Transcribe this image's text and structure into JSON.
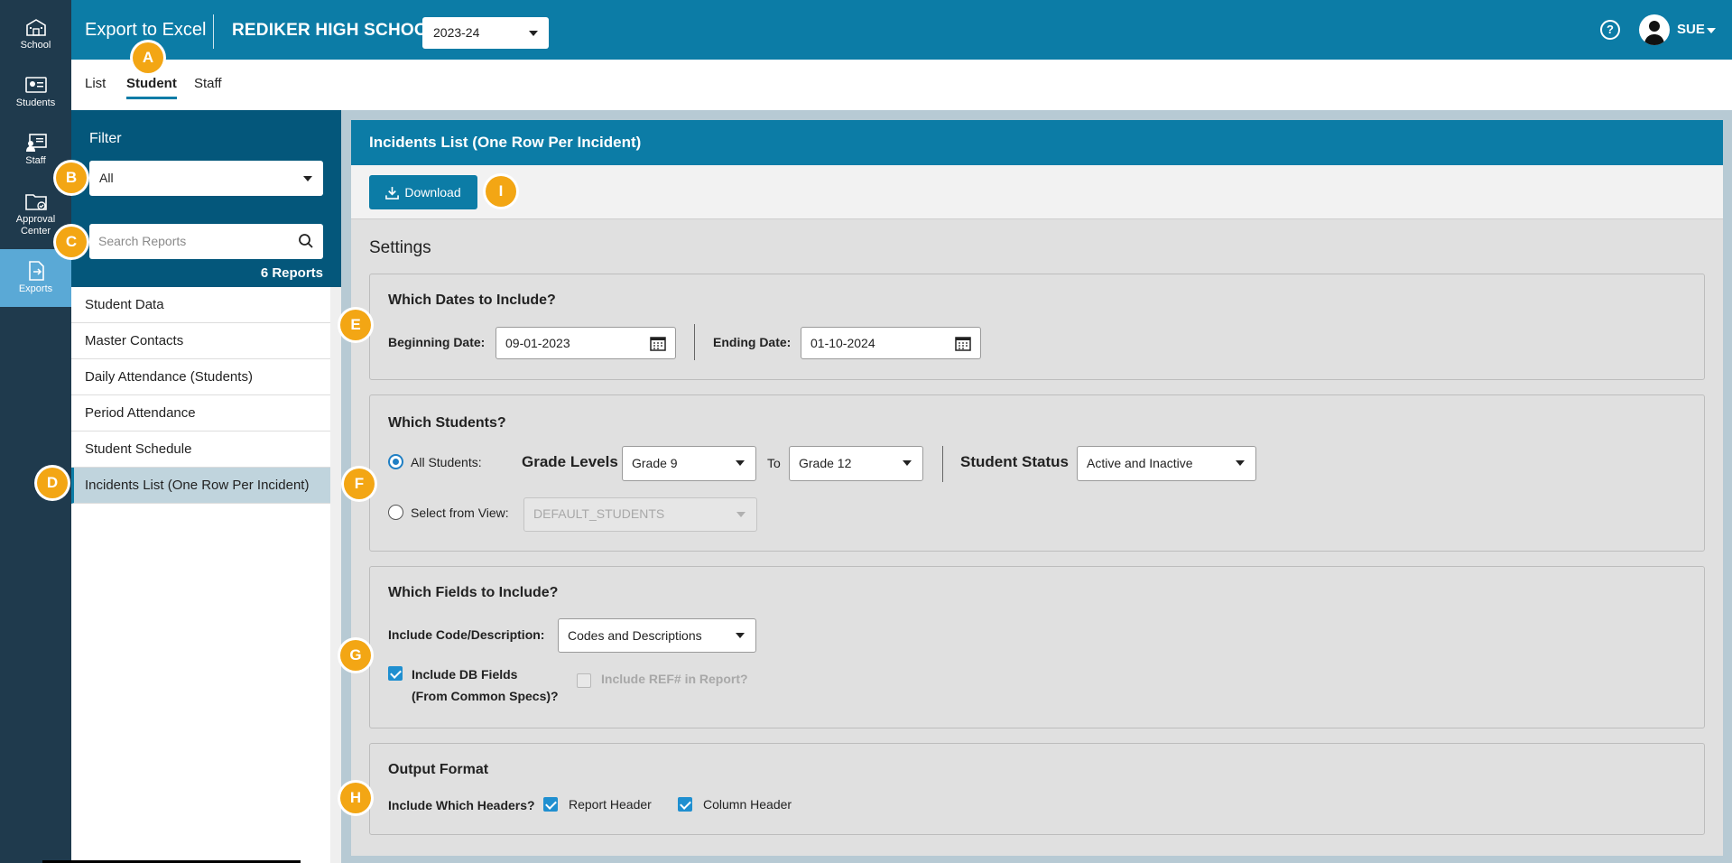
{
  "rail": {
    "items": [
      {
        "label": "School",
        "icon": "school-icon"
      },
      {
        "label": "Students",
        "icon": "students-icon"
      },
      {
        "label": "Staff",
        "icon": "staff-icon"
      },
      {
        "label": "Approval Center",
        "icon": "approval-center-icon"
      },
      {
        "label": "Exports",
        "icon": "exports-icon",
        "active": true
      }
    ]
  },
  "header": {
    "app_title": "Export to Excel",
    "school_name": "REDIKER HIGH SCHOOL",
    "year": "2023-24",
    "help_glyph": "?",
    "user": "SUE"
  },
  "tabs": [
    {
      "label": "List"
    },
    {
      "label": "Student",
      "active": true
    },
    {
      "label": "Staff"
    }
  ],
  "sidebar": {
    "filter_label": "Filter",
    "filter_value": "All",
    "search_placeholder": "Search Reports",
    "report_count": "6 Reports",
    "reports": [
      {
        "label": "Student Data"
      },
      {
        "label": "Master Contacts"
      },
      {
        "label": "Daily Attendance (Students)"
      },
      {
        "label": "Period Attendance"
      },
      {
        "label": "Student Schedule"
      },
      {
        "label": "Incidents List (One Row Per Incident)",
        "active": true
      }
    ]
  },
  "main": {
    "card_title": "Incidents List (One Row Per Incident)",
    "download_label": "Download",
    "settings_title": "Settings",
    "dates": {
      "title": "Which Dates to Include?",
      "begin_label": "Beginning Date:",
      "begin_value": "09-01-2023",
      "end_label": "Ending Date:",
      "end_value": "01-10-2024"
    },
    "students": {
      "title": "Which Students?",
      "all_label": "All Students:",
      "grade_levels_label": "Grade Levels",
      "grade_from": "Grade 9",
      "to_label": "To",
      "grade_to": "Grade 12",
      "status_label": "Student Status",
      "status_value": "Active and Inactive",
      "view_label": "Select from View:",
      "view_value": "DEFAULT_STUDENTS",
      "selected": "all"
    },
    "fields": {
      "title": "Which Fields to Include?",
      "code_label": "Include Code/Description:",
      "code_value": "Codes and Descriptions",
      "db_fields_line1": "Include DB Fields",
      "db_fields_line2": "(From Common Specs)?",
      "db_fields_checked": true,
      "ref_label": "Include REF# in Report?",
      "ref_checked": false
    },
    "output": {
      "title": "Output Format",
      "headers_label": "Include Which Headers?",
      "report_header_label": "Report Header",
      "report_header_checked": true,
      "column_header_label": "Column Header",
      "column_header_checked": true
    }
  },
  "callouts": {
    "a": "A",
    "b": "B",
    "c": "C",
    "d": "D",
    "e": "E",
    "f": "F",
    "g": "G",
    "h": "H",
    "i": "I"
  },
  "colors": {
    "header_blue": "#0c7ca6",
    "rail_dark": "#1f3a4d",
    "panel_blue": "#04577b",
    "callout_orange": "#f3a614",
    "active_rail": "#5aa9d6"
  }
}
